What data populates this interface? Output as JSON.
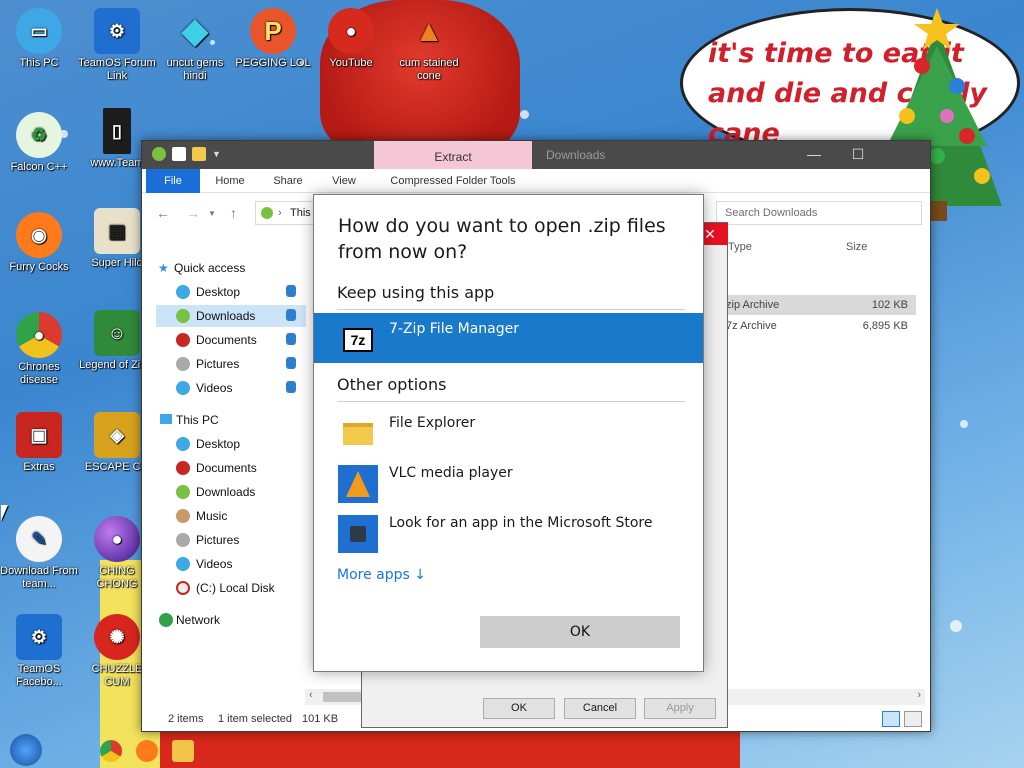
{
  "desktop": {
    "speech_bubble": "it's time to eat it and die and candy cane",
    "icons": [
      {
        "id": "this-pc",
        "label": "This PC"
      },
      {
        "id": "teamos-forum",
        "label": "TeamOS Forum Link"
      },
      {
        "id": "uncut-gems",
        "label": "uncut gems hindi"
      },
      {
        "id": "pegging",
        "label": "PEGGING LOL"
      },
      {
        "id": "youtube",
        "label": "YouTube"
      },
      {
        "id": "cum-cone",
        "label": "cum stained cone"
      },
      {
        "id": "falcon",
        "label": "Falcon C++"
      },
      {
        "id": "wwwteam",
        "label": "www.Team"
      },
      {
        "id": "furry-cocks",
        "label": "Furry Cocks"
      },
      {
        "id": "super-hilda",
        "label": "Super Hild"
      },
      {
        "id": "chrome",
        "label": "Chrones disease"
      },
      {
        "id": "legend",
        "label": "Legend of Zilda"
      },
      {
        "id": "extras",
        "label": "Extras"
      },
      {
        "id": "escape",
        "label": "ESCAPE CO"
      },
      {
        "id": "download",
        "label": "Download From team..."
      },
      {
        "id": "ching",
        "label": "CHING CHONG"
      },
      {
        "id": "teamos-fb",
        "label": "TeamOS Facebo..."
      },
      {
        "id": "chuzzle",
        "label": "CHUZZLE CUM"
      }
    ]
  },
  "explorer": {
    "context_tab": "Extract",
    "title": "Downloads",
    "ribbon_tabs": [
      "File",
      "Home",
      "Share",
      "View",
      "Compressed Folder Tools"
    ],
    "address_text": "This",
    "search_placeholder": "Search Downloads",
    "columns": {
      "type": "Type",
      "size": "Size"
    },
    "files": [
      {
        "type": "zip Archive",
        "size": "102 KB"
      },
      {
        "type": "7z Archive",
        "size": "6,895 KB"
      }
    ],
    "sidebar": {
      "quick_access": "Quick access",
      "quick_items": [
        "Desktop",
        "Downloads",
        "Documents",
        "Pictures",
        "Videos"
      ],
      "this_pc": "This PC",
      "pc_items": [
        "Desktop",
        "Documents",
        "Downloads",
        "Music",
        "Pictures",
        "Videos",
        "(C:) Local Disk"
      ],
      "network": "Network"
    },
    "status": {
      "items": "2 items",
      "selected": "1 item selected",
      "size": "101 KB"
    }
  },
  "properties": {
    "buttons": [
      "OK",
      "Cancel",
      "Apply"
    ]
  },
  "open_with": {
    "title": "How do you want to open .zip files from now on?",
    "keep_label": "Keep using this app",
    "current_app": "7-Zip File Manager",
    "other_label": "Other options",
    "other_apps": [
      "File Explorer",
      "VLC media player",
      "Look for an app in the Microsoft Store"
    ],
    "more_apps": "More apps ↓",
    "ok": "OK"
  },
  "colors": {
    "accent": "#1979ca",
    "ribbon_file": "#1a6ed8",
    "context_tab": "#f4c6d6"
  }
}
